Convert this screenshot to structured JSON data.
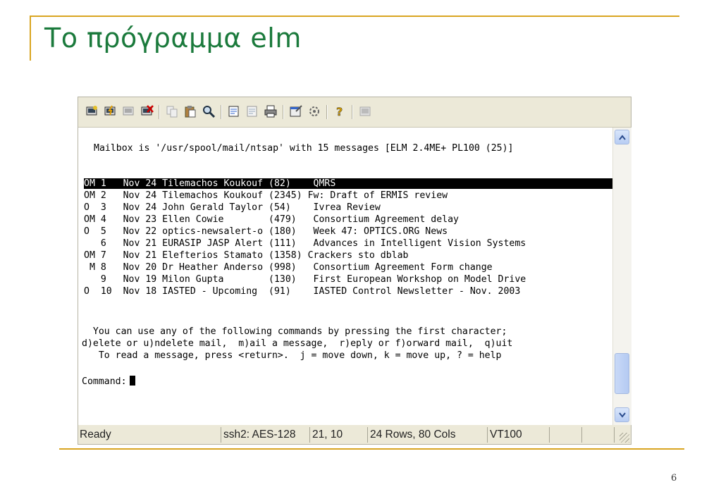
{
  "slide": {
    "title": "Το πρόγραμμα elm",
    "page_number": "6"
  },
  "toolbar": {
    "icons": [
      "new-connection-icon",
      "quick-connect-icon",
      "reconnect-icon",
      "disconnect-icon",
      "copy-icon",
      "paste-icon",
      "find-icon",
      "print-setup-icon",
      "print-selection-icon",
      "print-icon",
      "session-options-icon",
      "global-options-icon",
      "help-icon",
      "keymap-icon"
    ]
  },
  "terminal": {
    "header": "Mailbox is '/usr/spool/mail/ntsap' with 15 messages [ELM 2.4ME+ PL100 (25)]",
    "messages": [
      {
        "line": "OM 1   Nov 24 Tilemachos Koukouf (82)    QMRS",
        "selected": true
      },
      {
        "line": "OM 2   Nov 24 Tilemachos Koukouf (2345) Fw: Draft of ERMIS review",
        "selected": false
      },
      {
        "line": "O  3   Nov 24 John Gerald Taylor (54)    Ivrea Review",
        "selected": false
      },
      {
        "line": "OM 4   Nov 23 Ellen Cowie        (479)   Consortium Agreement delay",
        "selected": false
      },
      {
        "line": "O  5   Nov 22 optics-newsalert-o (180)   Week 47: OPTICS.ORG News",
        "selected": false
      },
      {
        "line": "   6   Nov 21 EURASIP JASP Alert (111)   Advances in Intelligent Vision Systems",
        "selected": false
      },
      {
        "line": "OM 7   Nov 21 Elefterios Stamato (1358) Crackers sto dblab",
        "selected": false
      },
      {
        "line": " M 8   Nov 20 Dr Heather Anderso (998)   Consortium Agreement Form change",
        "selected": false
      },
      {
        "line": "   9   Nov 19 Milon Gupta        (130)   First European Workshop on Model Drive",
        "selected": false
      },
      {
        "line": "O  10  Nov 18 IASTED - Upcoming  (91)    IASTED Control Newsletter - Nov. 2003",
        "selected": false
      }
    ],
    "help_lines": [
      "  You can use any of the following commands by pressing the first character;",
      "d)elete or u)ndelete mail,  m)ail a message,  r)eply or f)orward mail,  q)uit",
      "   To read a message, press <return>.  j = move down, k = move up, ? = help"
    ],
    "prompt": "Command:"
  },
  "statusbar": {
    "ready": "Ready",
    "encryption": "ssh2: AES-128",
    "cursor_pos": "21, 10",
    "size": "24 Rows, 80 Cols",
    "terminal_type": "VT100"
  }
}
